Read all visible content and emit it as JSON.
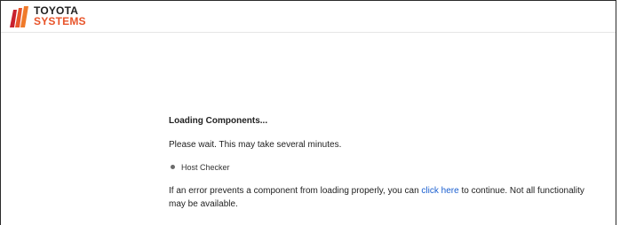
{
  "header": {
    "logo_line1": "TOYOTA",
    "logo_line2": "SYSTEMS",
    "logo_icon": "toyota-systems-logo-icon"
  },
  "colors": {
    "brand_orange": "#e8542a",
    "brand_red": "#c8202e",
    "link_blue": "#1a5fd0"
  },
  "main": {
    "title": "Loading Components...",
    "wait_message": "Please wait. This may take several minutes.",
    "components": [
      {
        "label": "Host Checker"
      }
    ],
    "error_before": "If an error prevents a component from loading properly, you can ",
    "link_label": "click here",
    "error_after": " to continue. Not all functionality may be available."
  }
}
